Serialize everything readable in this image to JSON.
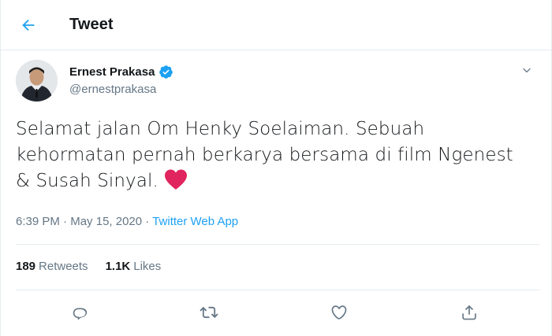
{
  "header": {
    "title": "Tweet",
    "back_icon": "arrow-left-icon"
  },
  "colors": {
    "accent": "#1da1f2",
    "text_primary": "#14171a",
    "text_secondary": "#657786",
    "heart": "#e0245e",
    "divider": "#e6ecf0"
  },
  "tweet": {
    "author_name": "Ernest Prakasa",
    "author_handle": "@ernestprakasa",
    "verified_icon": "verified-badge-icon",
    "text_line1": "Selamat jalan Om Henky Soelaiman. Sebuah",
    "text_line2": "kehormatan pernah berkarya bersama di film Ngenest",
    "text_line3": "& Susah Sinyal.",
    "emoji": "red-heart-icon",
    "time": "6:39 PM",
    "date": "May 15, 2020",
    "separator": "·",
    "source": "Twitter Web App"
  },
  "stats": {
    "retweets_count": "189",
    "retweets_label": "Retweets",
    "likes_count": "1.1K",
    "likes_label": "Likes"
  },
  "actions": {
    "reply_icon": "reply-icon",
    "retweet_icon": "retweet-icon",
    "like_icon": "like-heart-icon",
    "share_icon": "share-icon"
  }
}
